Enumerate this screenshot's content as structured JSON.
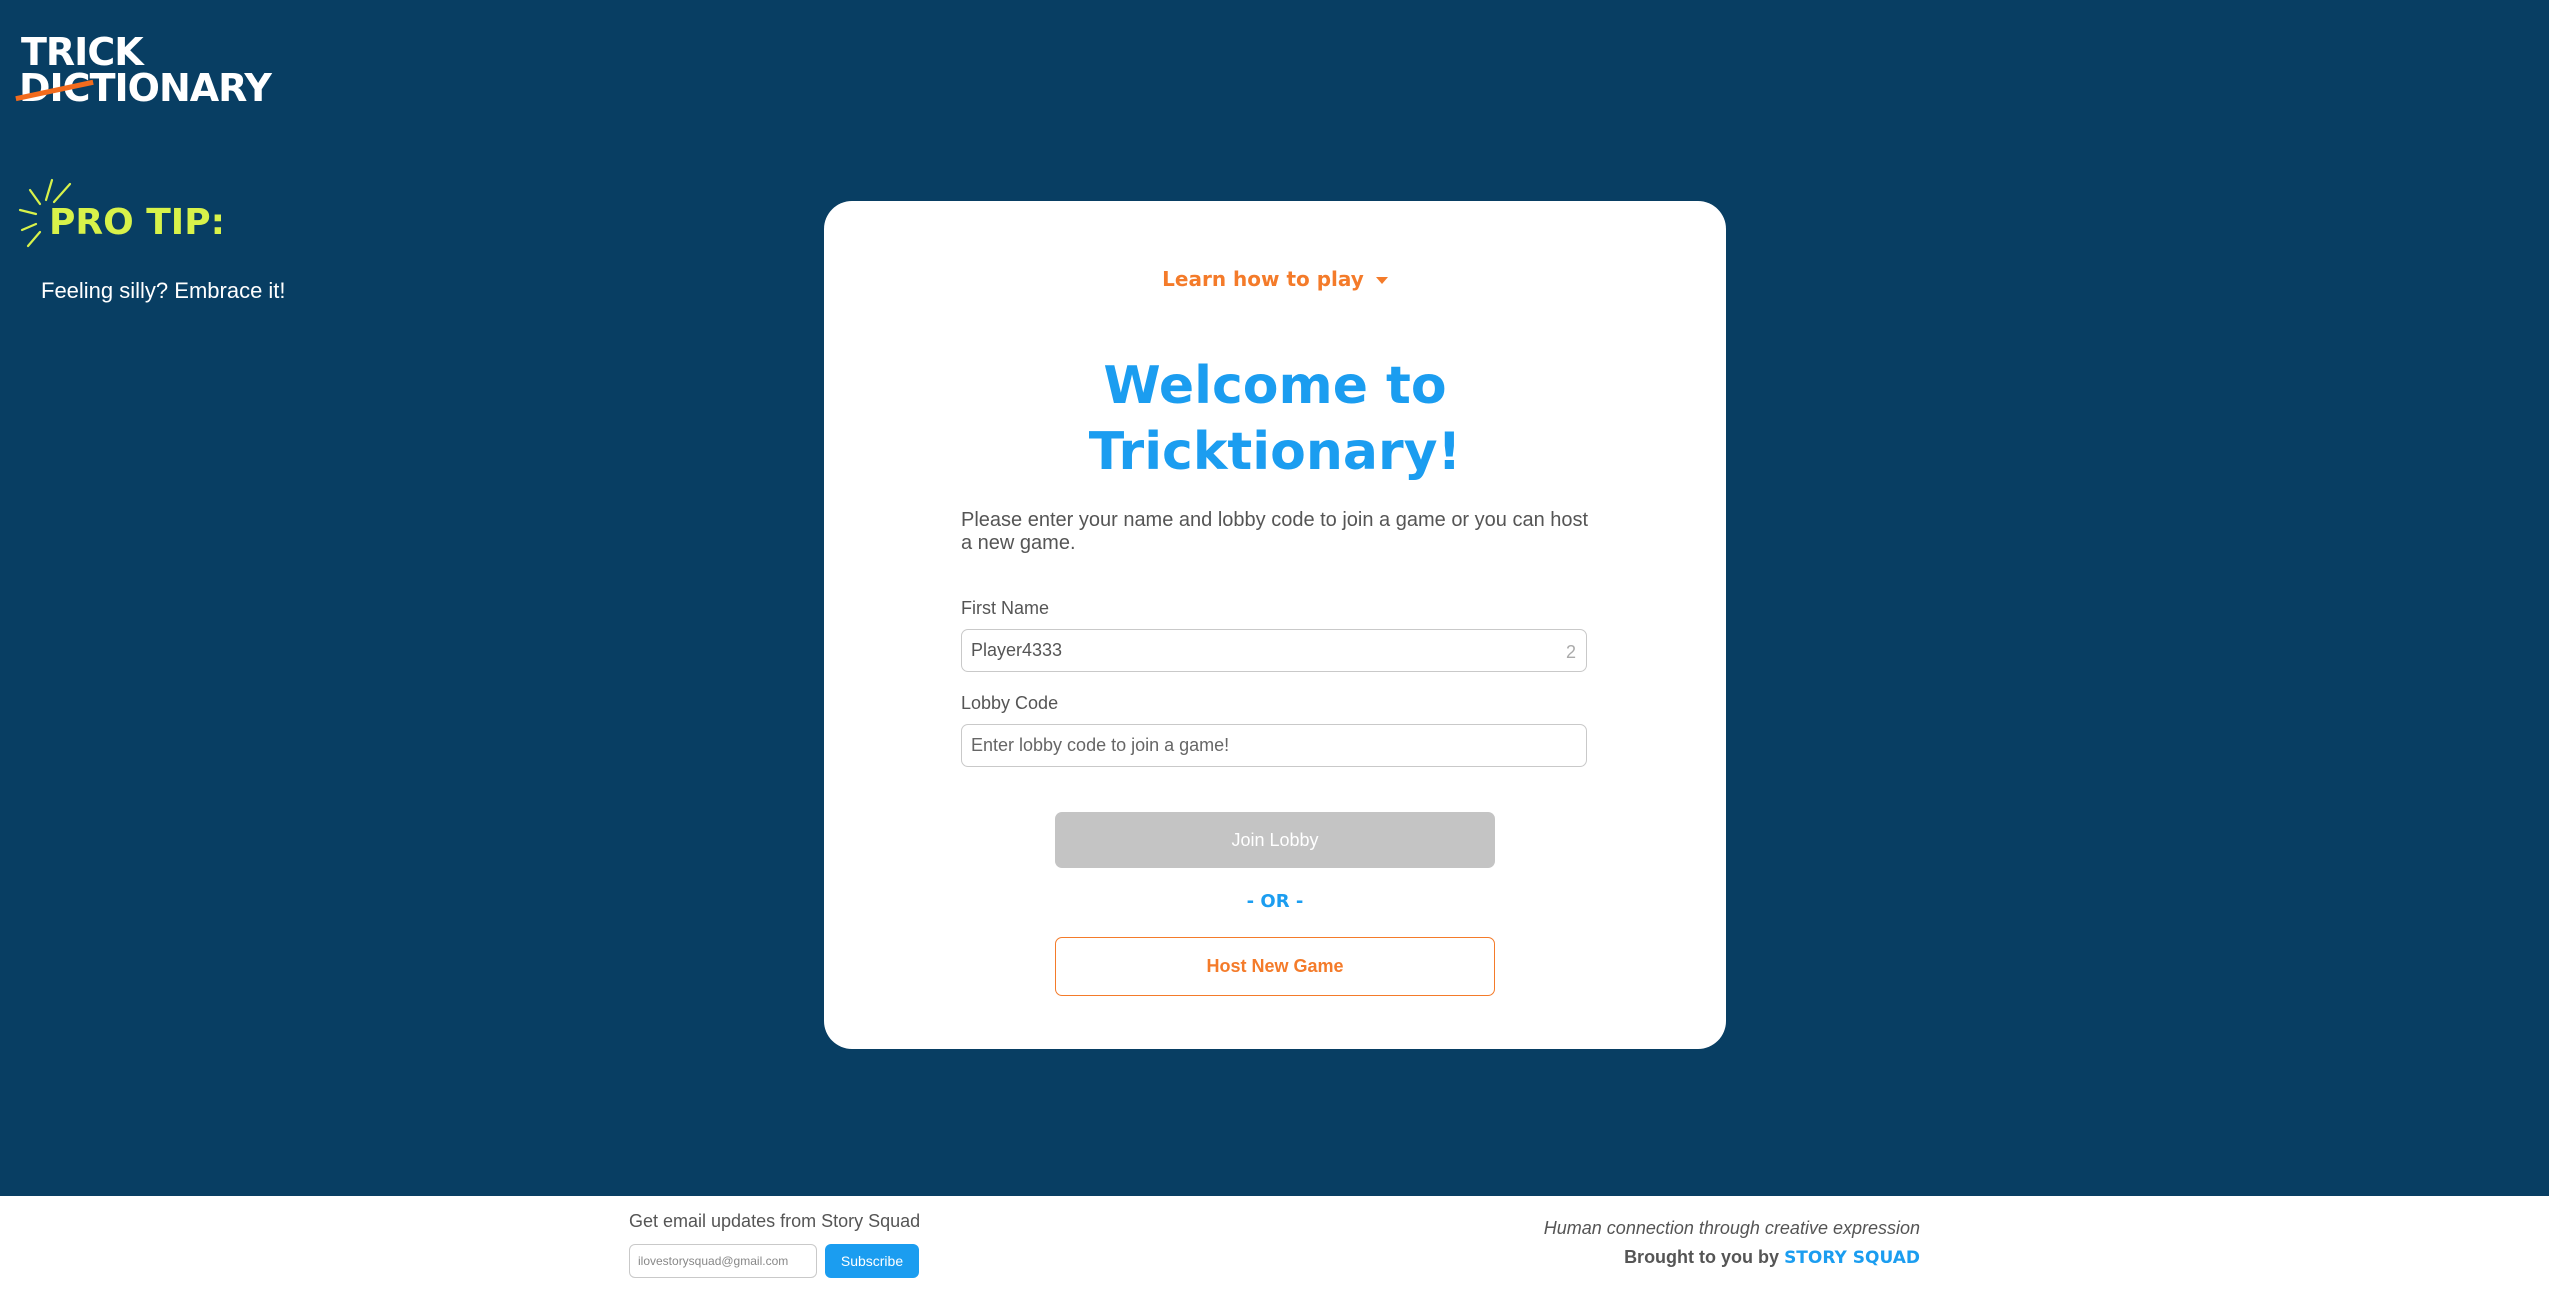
{
  "logo": {
    "line1": "TRICK",
    "strike": "DIC",
    "line2_rest": "TIONARY"
  },
  "pro_tip": {
    "title": "PRO TIP:",
    "text": "Feeling silly? Embrace it!"
  },
  "card": {
    "learn_link": "Learn how to play",
    "welcome_line1": "Welcome to",
    "welcome_line2": "Tricktionary!",
    "intro": "Please enter your name and lobby code to join a game or you can host a new game.",
    "first_name_label": "First Name",
    "first_name_value": "Player4333",
    "first_name_count": "2",
    "lobby_code_label": "Lobby Code",
    "lobby_code_placeholder": "Enter lobby code to join a game!",
    "join_button": "Join Lobby",
    "or_text": "- OR -",
    "host_button": "Host New Game"
  },
  "footer": {
    "email_label": "Get email updates from Story Squad",
    "email_placeholder": "ilovestorysquad@gmail.com",
    "subscribe_button": "Subscribe",
    "tagline": "Human connection through creative expression",
    "brought_by": "Brought to you by",
    "brand": "STORY SQUAD"
  },
  "colors": {
    "background": "#083e63",
    "accent_blue": "#1b9df0",
    "accent_orange": "#f47b2a",
    "pro_tip_yellow": "#d8f24a",
    "disabled_gray": "#c4c4c4"
  },
  "icons": [
    "burst-icon",
    "caret-down-icon"
  ]
}
